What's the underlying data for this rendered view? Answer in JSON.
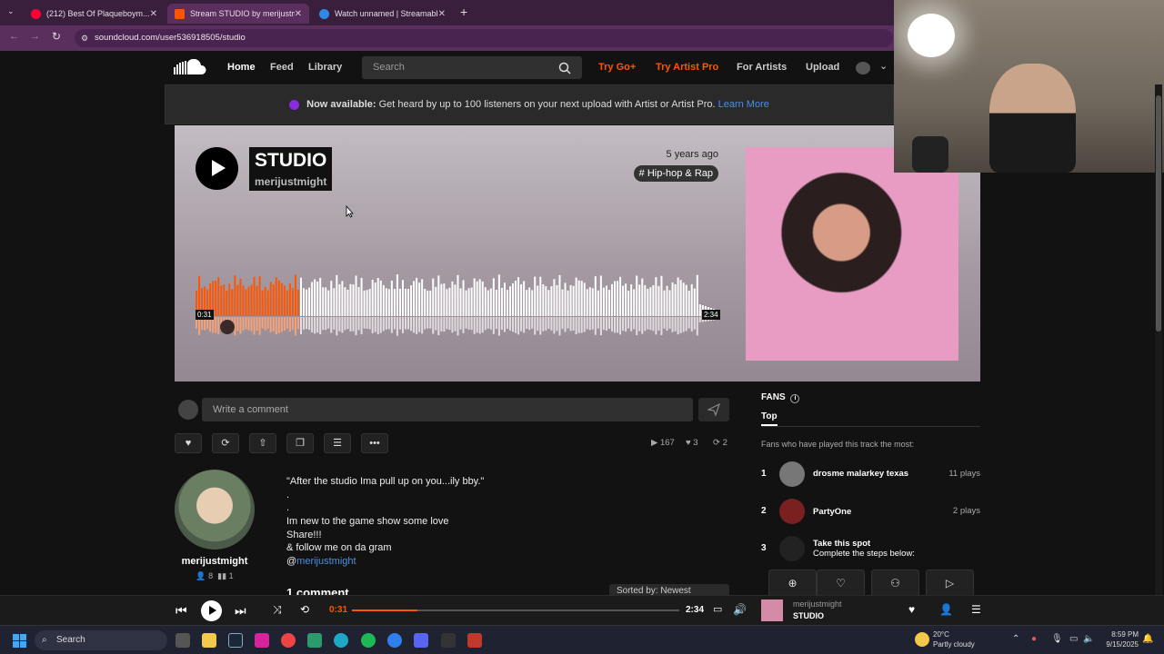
{
  "browser": {
    "tabs": [
      {
        "label": "(212) Best Of Plaqueboym..."
      },
      {
        "label": "Stream STUDIO by merijustmig..."
      },
      {
        "label": "Watch unnamed | Streamable"
      }
    ],
    "url": "soundcloud.com/user536918505/studio"
  },
  "header": {
    "nav": [
      "Home",
      "Feed",
      "Library"
    ],
    "search_placeholder": "Search",
    "try_go": "Try Go+",
    "try_artist": "Try Artist Pro",
    "for_artists": "For Artists",
    "upload": "Upload"
  },
  "banner": {
    "bold": "Now available:",
    "text": " Get heard by up to 100 listeners on your next upload with Artist or Artist Pro. ",
    "link": "Learn More"
  },
  "track": {
    "title": "STUDIO",
    "artist": "merijustmight",
    "posted": "5 years ago",
    "genre": "# Hip-hop & Rap",
    "current_time": "0:31",
    "duration": "2:34",
    "progress": 0.2
  },
  "comment": {
    "placeholder": "Write a comment"
  },
  "stats": {
    "plays": "167",
    "likes": "3",
    "reposts": "2"
  },
  "uploader": {
    "name": "merijustmight",
    "followers": "8",
    "tracks": "1"
  },
  "description": {
    "line1": "\"After the studio Ima pull up on you...ily bby.\"",
    "dot1": ".",
    "dot2": ".",
    "line2": "Im new to the game show some love",
    "line3": "Share!!!",
    "line4": "& follow me on da gram",
    "mention_prefix": "@",
    "mention": "merijustmight"
  },
  "comments_section": {
    "count_label": "1 comment",
    "sort_label": "Sorted by: Newest"
  },
  "fans": {
    "heading": "FANS",
    "tab": "Top",
    "subtitle": "Fans who have played this track the most:",
    "list": [
      {
        "rank": "1",
        "name": "drosme malarkey texas",
        "plays": "11 plays"
      },
      {
        "rank": "2",
        "name": "PartyOne",
        "plays": "2 plays"
      },
      {
        "rank": "3",
        "name": "Take this spot",
        "plays": "Complete the steps below:"
      }
    ],
    "buttons": [
      "Listen",
      "Like",
      "Follow",
      "Play"
    ]
  },
  "player": {
    "current": "0:31",
    "duration": "2:34",
    "progress": 0.2,
    "artist": "merijustmight",
    "title": "STUDIO"
  },
  "taskbar": {
    "search": "Search",
    "weather_temp": "20°C",
    "weather_desc": "Partly cloudy",
    "time": "8:59 PM",
    "date": "9/15/2025"
  },
  "colors": {
    "accent": "#ff5500",
    "link": "#4a90e2"
  }
}
